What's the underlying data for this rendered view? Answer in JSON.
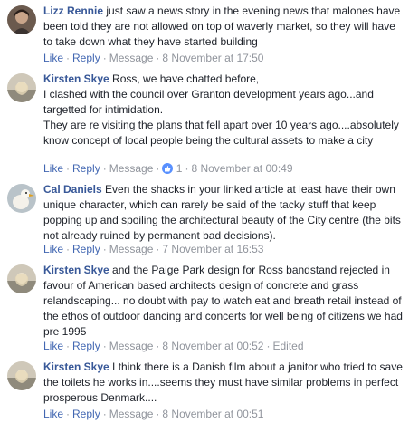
{
  "comments": [
    {
      "author": "Lizz Rennie",
      "text": "just saw a news story in the evening news that malones have been told they are not allowed on top of waverly market, so they will have to take down what they have started building",
      "actions": {
        "like": "Like",
        "reply": "Reply",
        "message": "Message",
        "timestamp": "8 November at 17:50"
      }
    },
    {
      "author": "Kirsten Skye",
      "text": "Ross, we have chatted before,\nI clashed with the council over Granton development years ago...and targetted for intimidation.\nThey are re visiting the plans that fell apart over 10 years ago....absolutely know concept of local people being the cultural assets to make a city",
      "actions": {
        "like": "Like",
        "reply": "Reply",
        "message": "Message",
        "reaction_count": "1",
        "timestamp": "8 November at 00:49"
      }
    },
    {
      "author": "Cal Daniels",
      "text": "Even the shacks in your linked article at least have their own unique character, which can rarely be said of the tacky stuff that keep popping up and spoiling the architectural beauty of the City centre (the bits not already ruined by permanent bad decisions).",
      "actions": {
        "like": "Like",
        "reply": "Reply",
        "message": "Message",
        "timestamp": "7 November at 16:53"
      }
    },
    {
      "author": "Kirsten Skye",
      "text": "and the Paige Park design for Ross bandstand rejected in favour of American based architects design of concrete and grass relandscaping... no doubt with pay to watch eat and breath retail instead of the ethos of outdoor dancing and concerts for well being of citizens we had pre 1995",
      "actions": {
        "like": "Like",
        "reply": "Reply",
        "message": "Message",
        "timestamp": "8 November at 00:52",
        "edited": "Edited"
      }
    },
    {
      "author": "Kirsten Skye",
      "text": "I think there is a Danish film about a janitor who tried to save the toilets he works in....seems they must have similar problems in perfect prosperous Denmark....",
      "actions": {
        "like": "Like",
        "reply": "Reply",
        "message": "Message",
        "timestamp": "8 November at 00:51"
      }
    }
  ],
  "colors": {
    "author": "#385898",
    "action": "#4267b2",
    "muted": "#90949c",
    "text": "#1d2129",
    "like_badge": "#5890ff"
  },
  "icons": {
    "reaction": "thumbs-up-icon"
  }
}
